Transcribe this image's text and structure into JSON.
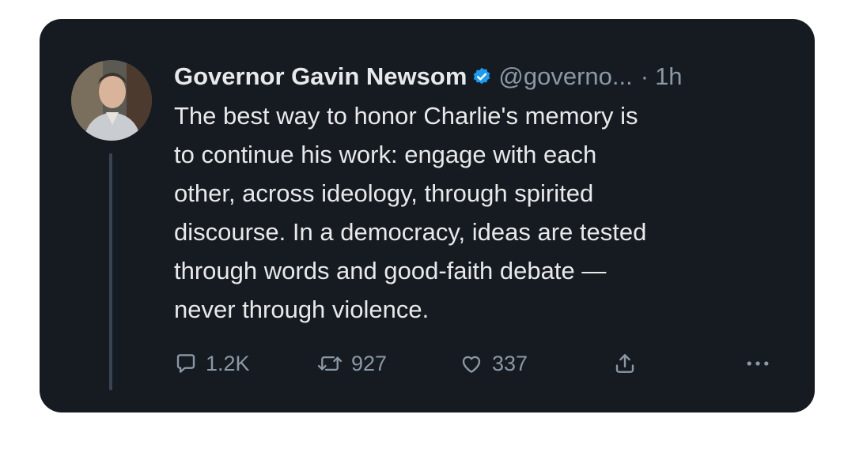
{
  "tweet": {
    "author_name": "Governor Gavin Newsom",
    "handle": "@governo...",
    "separator": "·",
    "time": "1h",
    "verified_icon": "verified-badge-icon",
    "avatar_icon": "avatar-photo",
    "lines": [
      "The best way to honor Charlie's memory is",
      "to continue his work: engage with each",
      "other, across ideology, through spirited",
      "discourse. In a democracy, ideas are tested",
      "through words and good-faith debate —",
      "never through violence."
    ]
  },
  "actions": {
    "reply_count": "1.2K",
    "retweet_count": "927",
    "like_count": "337"
  },
  "colors": {
    "card_background": "#161b22",
    "text_primary": "#e7e9ea",
    "text_secondary": "#8b98a5",
    "verified": "#1d9bf0"
  }
}
